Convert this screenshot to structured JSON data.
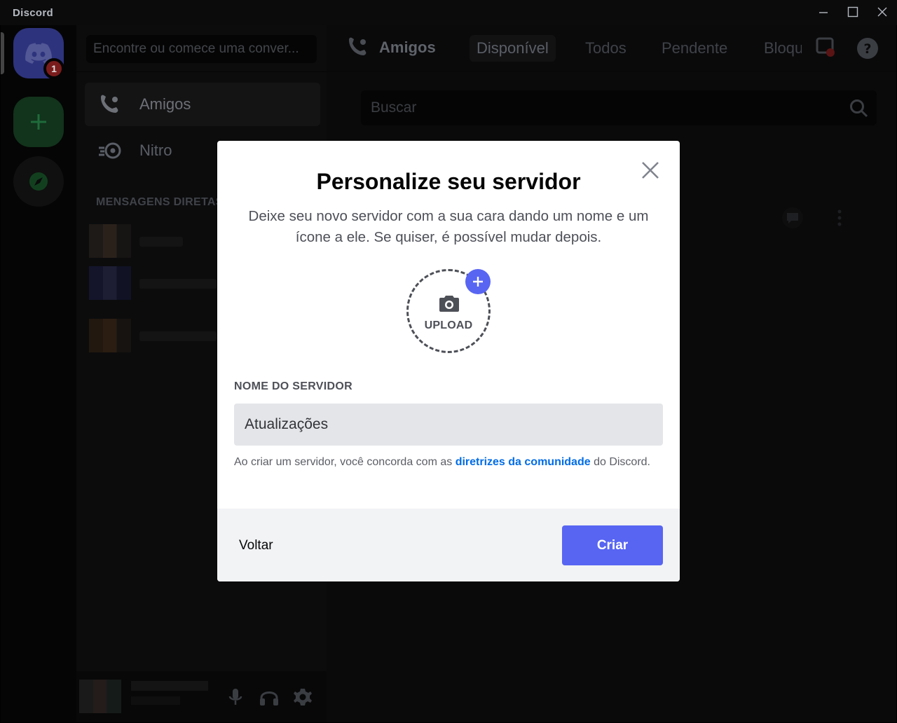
{
  "window": {
    "title": "Discord"
  },
  "guild_rail": {
    "home_badge": "1",
    "add_server_icon": "plus-icon",
    "explore_icon": "compass-icon"
  },
  "sidebar": {
    "search_placeholder": "Encontre ou comece uma conver...",
    "items": [
      {
        "label": "Amigos",
        "icon": "friends-icon"
      },
      {
        "label": "Nitro",
        "icon": "nitro-icon"
      }
    ],
    "dm_header": "MENSAGENS DIRETAS"
  },
  "topbar": {
    "title": "Amigos",
    "tabs": [
      "Disponível",
      "Todos",
      "Pendente",
      "Bloqueado"
    ]
  },
  "main": {
    "search_placeholder": "Buscar"
  },
  "modal": {
    "title": "Personalize seu servidor",
    "description": "Deixe seu novo servidor com a sua cara dando um nome e um ícone a ele. Se quiser, é possível mudar depois.",
    "upload_label": "UPLOAD",
    "field_label": "NOME DO SERVIDOR",
    "field_value": "Atualizações",
    "terms_prefix": "Ao criar um servidor, você concorda com as ",
    "terms_link": "diretrizes da comunidade",
    "terms_suffix": " do Discord.",
    "back_label": "Voltar",
    "create_label": "Criar"
  },
  "colors": {
    "brand": "#5865f2",
    "link": "#006ce7",
    "modal_bg": "#ffffff",
    "modal_footer_bg": "#f2f3f5",
    "input_bg": "#e3e5e8"
  }
}
